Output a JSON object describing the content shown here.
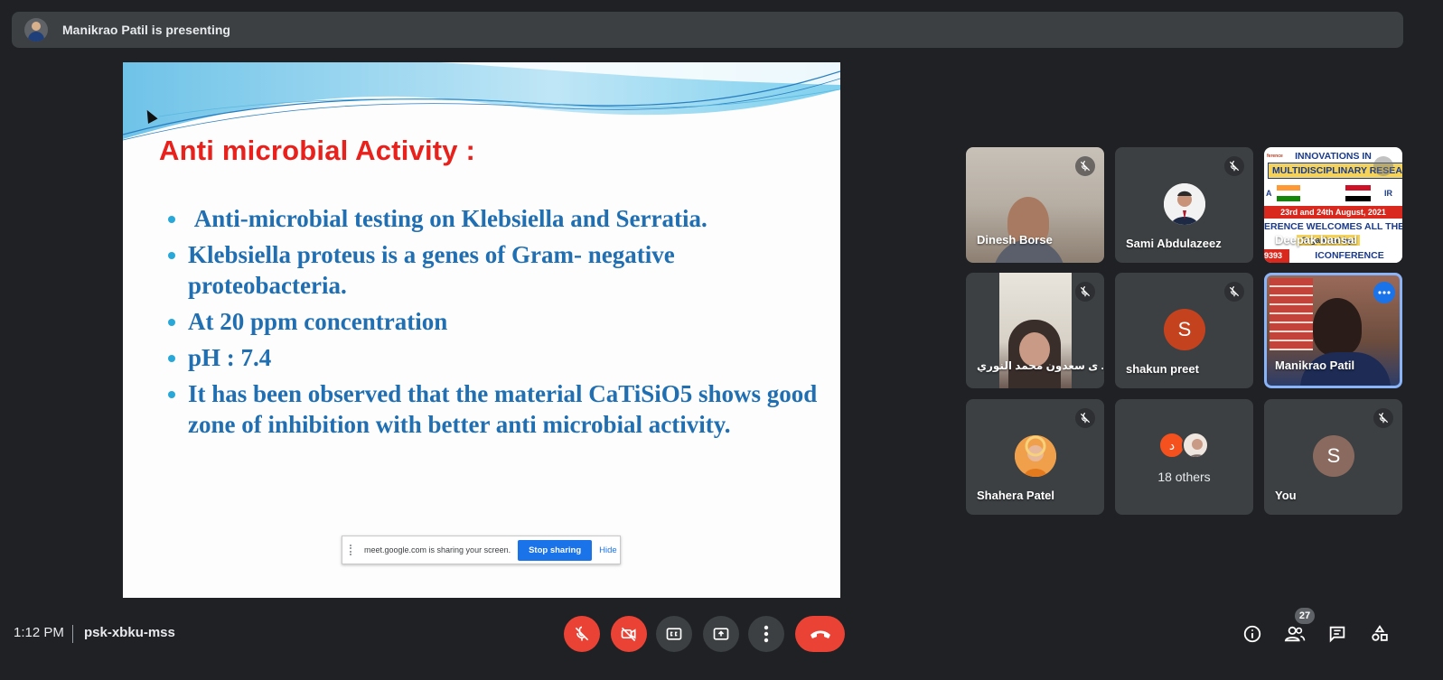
{
  "presenting_bar": {
    "text": "Manikrao Patil is presenting"
  },
  "slide": {
    "title": "Anti microbial Activity :",
    "bullets": [
      " Anti-microbial testing on Klebsiella and Serratia.",
      "Klebsiella proteus is a genes of Gram- negative proteobacteria.",
      "At 20 ppm concentration",
      "pH : 7.4",
      "It has been observed that the material CaTiSiO5 shows good zone of inhibition with better anti microbial activity."
    ],
    "share_notice": {
      "text": "meet.google.com is sharing your screen.",
      "stop_label": "Stop sharing",
      "hide_label": "Hide"
    }
  },
  "participants": [
    {
      "name": "Dinesh Borse",
      "muted": true
    },
    {
      "name": "Sami Abdulazeez",
      "muted": true
    },
    {
      "name": "Deepak bansal",
      "muted": false
    },
    {
      "name": "ى سعدون محمد النوري ...",
      "muted": true
    },
    {
      "name": "shakun preet",
      "muted": true,
      "avatar_letter": "S",
      "avatar_color": "#c5421e"
    },
    {
      "name": "Manikrao Patil",
      "muted": false
    },
    {
      "name": "Shahera Patel",
      "muted": true
    },
    {
      "name": "18 others",
      "muted": false
    },
    {
      "name": "You",
      "muted": true,
      "avatar_letter": "S",
      "avatar_color": "#8a6a5f"
    }
  ],
  "others_avatar": {
    "letter": "د",
    "color": "#f4511e"
  },
  "banner": {
    "line1": "INNOVATIONS IN",
    "line2": "MULTIDISCIPLINARY RESEA",
    "left_code": "A",
    "right_code": "IR",
    "date": "23rd and 24th August, 2021",
    "welcome": "ERENCE WELCOMES ALL THE DELE",
    "organized": "Organized by:",
    "number": "9393",
    "conference": "ICONFERENCE",
    "tag": "ference"
  },
  "bottom_bar": {
    "time": "1:12 PM",
    "meeting_code": "psk-xbku-mss",
    "participant_count": "27"
  },
  "colors": {
    "accent_blue": "#1a73e8",
    "end_call_red": "#ea4335",
    "surface": "#3c4043",
    "background": "#202124"
  }
}
